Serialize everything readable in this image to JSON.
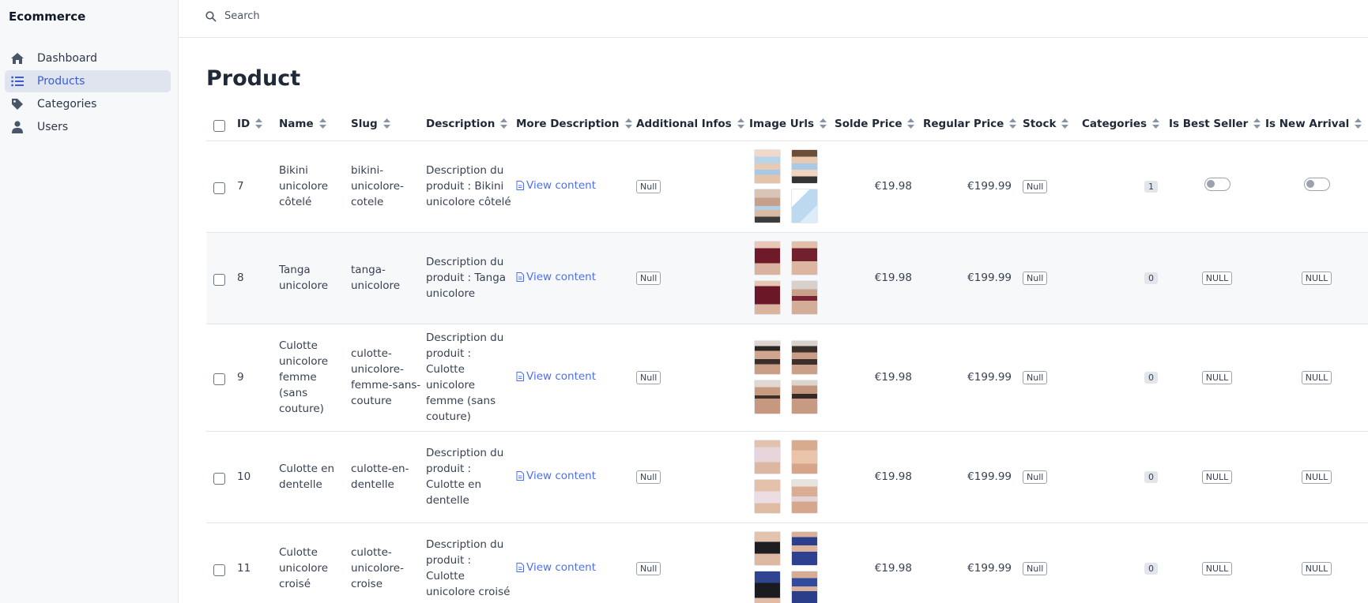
{
  "app": {
    "brand": "Ecommerce"
  },
  "sidebar": {
    "items": [
      {
        "label": "Dashboard",
        "icon": "home-icon"
      },
      {
        "label": "Products",
        "icon": "list-icon",
        "active": true
      },
      {
        "label": "Categories",
        "icon": "tag-icon"
      },
      {
        "label": "Users",
        "icon": "user-icon"
      }
    ]
  },
  "search": {
    "placeholder": "Search"
  },
  "page": {
    "title": "Product"
  },
  "table": {
    "columns": [
      "ID",
      "Name",
      "Slug",
      "Description",
      "More Description",
      "Additional Infos",
      "Image Urls",
      "Solde Price",
      "Regular Price",
      "Stock",
      "Categories",
      "Is Best Seller",
      "Is New Arrival"
    ],
    "rows": [
      {
        "id": "7",
        "name": "Bikini unicolore côtelé",
        "slug": "bikini-unicolore-cotele",
        "description": "Description du produit : Bikini unicolore côtelé",
        "more": "View content",
        "additional": "Null",
        "solde": "€19.98",
        "regular": "€199.99",
        "stock": "Null",
        "categories": "1",
        "best_seller": "toggle",
        "new_arrival": "toggle"
      },
      {
        "id": "8",
        "name": "Tanga unicolore",
        "slug": "tanga-unicolore",
        "description": "Description du produit : Tanga unicolore",
        "more": "View content",
        "additional": "Null",
        "solde": "€19.98",
        "regular": "€199.99",
        "stock": "Null",
        "categories": "0",
        "best_seller": "NULL",
        "new_arrival": "NULL"
      },
      {
        "id": "9",
        "name": "Culotte unicolore femme (sans couture)",
        "slug": "culotte-unicolore-femme-sans-couture",
        "description": "Description du produit : Culotte unicolore femme (sans couture)",
        "more": "View content",
        "additional": "Null",
        "solde": "€19.98",
        "regular": "€199.99",
        "stock": "Null",
        "categories": "0",
        "best_seller": "NULL",
        "new_arrival": "NULL"
      },
      {
        "id": "10",
        "name": "Culotte en dentelle",
        "slug": "culotte-en-dentelle",
        "description": "Description du produit : Culotte en dentelle",
        "more": "View content",
        "additional": "Null",
        "solde": "€19.98",
        "regular": "€199.99",
        "stock": "Null",
        "categories": "0",
        "best_seller": "NULL",
        "new_arrival": "NULL"
      },
      {
        "id": "11",
        "name": "Culotte unicolore croisé",
        "slug": "culotte-unicolore-croise",
        "description": "Description du produit : Culotte unicolore croisé",
        "more": "View content",
        "additional": "Null",
        "solde": "€19.98",
        "regular": "€199.99",
        "stock": "Null",
        "categories": "0",
        "best_seller": "NULL",
        "new_arrival": "NULL"
      }
    ]
  },
  "colors": {
    "accent": "#4c6ef5",
    "active_bg": "#dfe4ee",
    "sidebar_bg": "#f7f8fa"
  }
}
